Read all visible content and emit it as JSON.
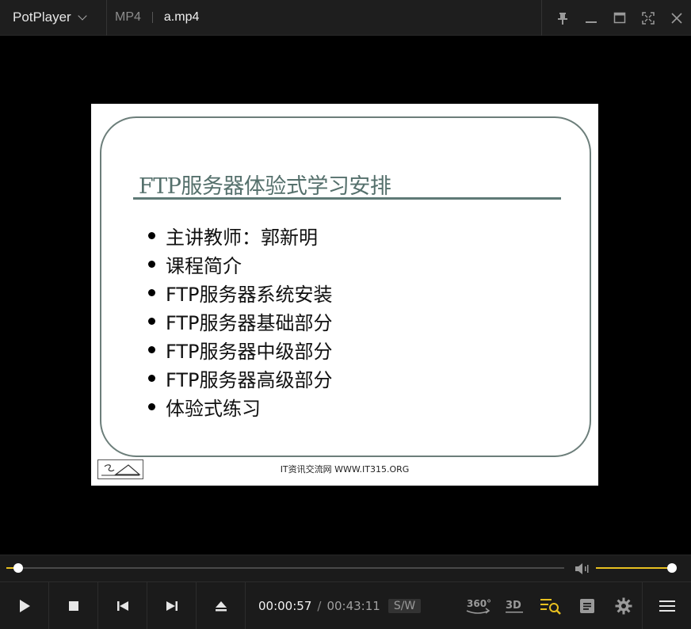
{
  "titlebar": {
    "brand": "PotPlayer",
    "format": "MP4",
    "filename": "a.mp4"
  },
  "window_controls": [
    "pin-icon",
    "minimize-icon",
    "maximize-icon",
    "fullscreen-icon",
    "close-icon"
  ],
  "slide": {
    "title": "FTP服务器体验式学习安排",
    "bullets": [
      "主讲教师：郭新明",
      "课程简介",
      "FTP服务器系统安装",
      "FTP服务器基础部分",
      "FTP服务器中级部分",
      "FTP服务器高级部分",
      "体验式练习"
    ],
    "footer": "IT资讯交流网 WWW.IT315.ORG"
  },
  "playback": {
    "current_time": "00:00:57",
    "separator": "/",
    "total_time": "00:43:11",
    "sw_label": "S/W",
    "progress_fraction": 0.022,
    "volume_fraction": 1.0
  },
  "controls": {
    "vr_label": "360°",
    "threed_label": "3D"
  },
  "colors": {
    "accent": "#e8c020",
    "titlebar_bg": "#1e1e1e",
    "controlbar_bg": "#1b1b1b",
    "slide_title": "#55706c",
    "slide_frame": "#6c7e7a"
  }
}
